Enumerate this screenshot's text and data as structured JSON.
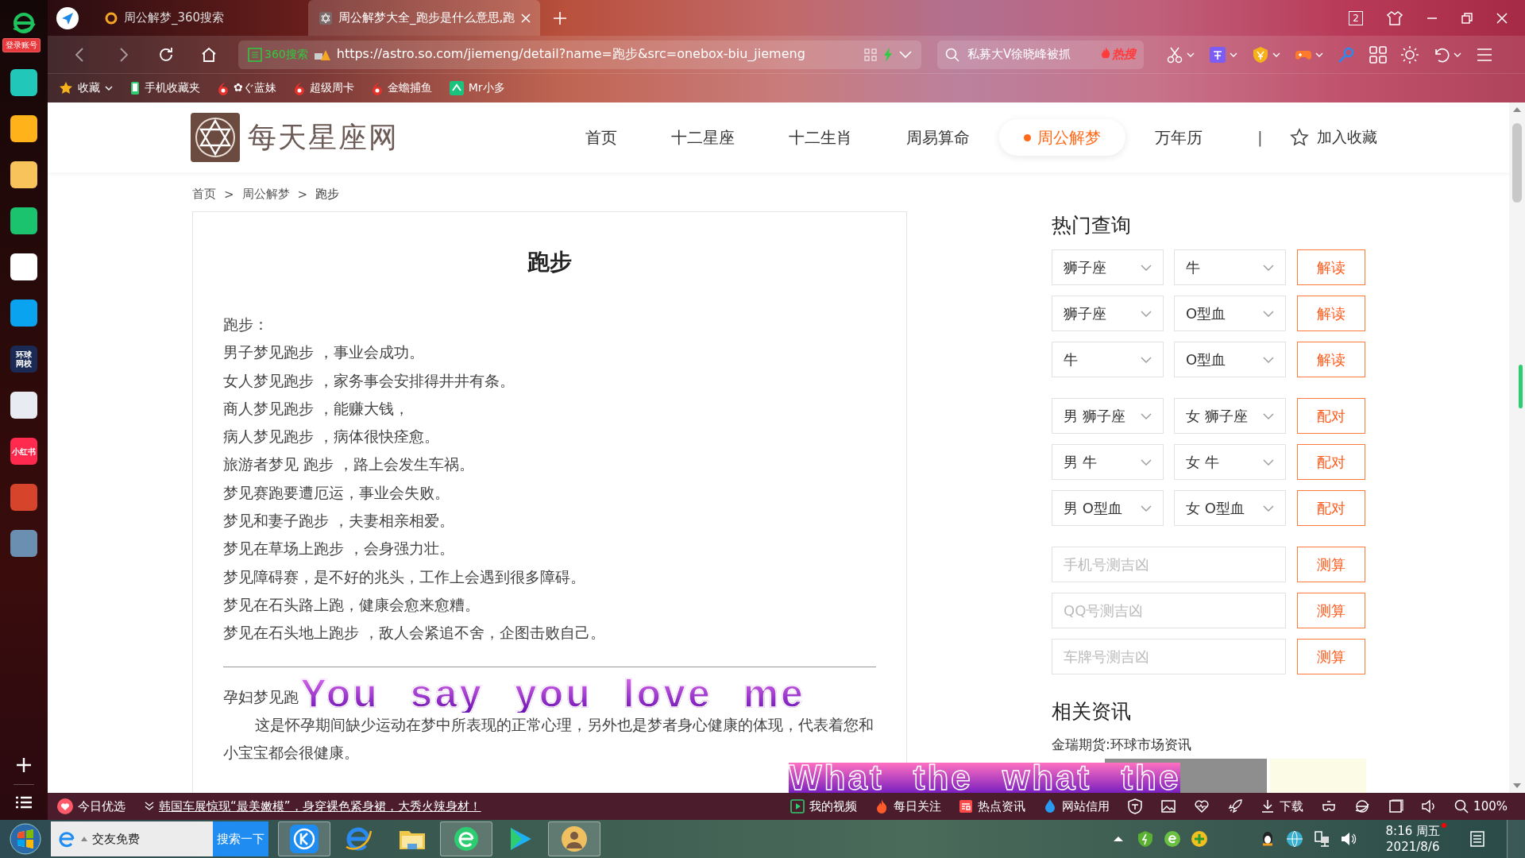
{
  "browser": {
    "tabs": [
      {
        "title": "周公解梦_360搜索",
        "selected": false
      },
      {
        "title": "周公解梦大全_跑步是什么意思,跑",
        "selected": true
      }
    ],
    "window_count": "2",
    "address": {
      "security_label": "360搜索",
      "url": "https://astro.so.com/jiemeng/detail?name=跑步&src=onebox-biu_jiemeng"
    },
    "search": {
      "value": "私募大V徐晓峰被抓",
      "badge": "热搜"
    },
    "bookmarks": [
      {
        "label": "收藏",
        "kind": "star"
      },
      {
        "label": "手机收藏夹",
        "kind": "phone"
      },
      {
        "label": "✿ぐ蓝妹",
        "kind": "six"
      },
      {
        "label": "超级周卡",
        "kind": "six"
      },
      {
        "label": "金蟾捕鱼",
        "kind": "six"
      },
      {
        "label": "Mr小多",
        "kind": "app"
      }
    ]
  },
  "dock": {
    "login_badge": "登录账号",
    "apps": [
      {
        "color": "#21c7b8"
      },
      {
        "color": "#ffb219"
      },
      {
        "color": "#f7c35a"
      },
      {
        "color": "#1cc36e"
      },
      {
        "color": "#ffffff"
      },
      {
        "color": "#0aa3f0"
      },
      {
        "color": "#1b2a55",
        "label": "环球网校"
      },
      {
        "color": "#e8ecf2"
      },
      {
        "color": "#ff2a4d",
        "label": "小红书"
      },
      {
        "color": "#d6442c"
      },
      {
        "color": "#6a8fb0"
      }
    ]
  },
  "site": {
    "logo": "每天星座网",
    "nav": [
      {
        "label": "首页",
        "selected": false
      },
      {
        "label": "十二星座",
        "selected": false
      },
      {
        "label": "十二生肖",
        "selected": false
      },
      {
        "label": "周易算命",
        "selected": false
      },
      {
        "label": "周公解梦",
        "selected": true
      },
      {
        "label": "万年历",
        "selected": false
      }
    ],
    "nav_divider": "|",
    "favorite": "加入收藏",
    "breadcrumb": [
      {
        "label": "首页",
        "separator": ">"
      },
      {
        "label": "周公解梦",
        "separator": ">"
      },
      {
        "label": "跑步"
      }
    ],
    "article": {
      "title": "跑步",
      "intro": "跑步：",
      "lines": [
        "男子梦见跑步 ，事业会成功。",
        "女人梦见跑步 ，家务事会安排得井井有条。",
        "商人梦见跑步 ，能赚大钱，",
        "病人梦见跑步 ，病体很快痊愈。",
        "旅游者梦见 跑步 ，路上会发生车祸。",
        "梦见赛跑要遭厄运，事业会失败。",
        "梦见和妻子跑步 ，夫妻相亲相爱。",
        "梦见在草场上跑步 ，会身强力壮。",
        "梦见障碍赛，是不好的兆头，工作上会遇到很多障碍。",
        "梦见在石头路上跑，健康会愈来愈糟。",
        "梦见在石头地上跑步 ，敌人会紧追不舍，企图击败自己。"
      ],
      "section_heading": "孕妇梦见跑",
      "section_text": "这是怀孕期间缺少运动在梦中所表现的正常心理，另外也是梦者身心健康的体现，代表着您和小宝宝都会很健康。"
    }
  },
  "query": {
    "title": "热门查询",
    "groups": [
      [
        {
          "kind": "pair",
          "first": "狮子座",
          "second": "牛",
          "button": "解读"
        },
        {
          "kind": "pair",
          "first": "狮子座",
          "second": "O型血",
          "button": "解读"
        },
        {
          "kind": "pair",
          "first": "牛",
          "second": "O型血",
          "button": "解读"
        }
      ],
      [
        {
          "kind": "pair",
          "first": "男 狮子座",
          "second": "女 狮子座",
          "button": "配对"
        },
        {
          "kind": "pair",
          "first": "男 牛",
          "second": "女 牛",
          "button": "配对"
        },
        {
          "kind": "pair",
          "first": "男 O型血",
          "second": "女 O型血",
          "button": "配对"
        }
      ],
      [
        {
          "kind": "input",
          "placeholder": "手机号测吉凶",
          "button": "测算"
        },
        {
          "kind": "input",
          "placeholder": "QQ号测吉凶",
          "button": "测算"
        },
        {
          "kind": "input",
          "placeholder": "车牌号测吉凶",
          "button": "测算"
        }
      ]
    ],
    "news_title": "相关资讯",
    "news_item": "金瑞期货:环球市场资讯"
  },
  "status_bar": {
    "pick": "今日优选",
    "headline": "韩国车展惊现“最美嫩模”，身穿裸色紧身裙，大秀火辣身材！",
    "links": [
      "我的视频",
      "每日关注",
      "热点资讯",
      "网站信用"
    ],
    "download": "下载",
    "zoom": "100%"
  },
  "taskbar": {
    "search_value": "交友免费",
    "search_button": "搜索一下",
    "time": "8:16 周五",
    "date": "2021/8/6"
  },
  "lyrics": [
    "You say you love me",
    "What the what the"
  ]
}
